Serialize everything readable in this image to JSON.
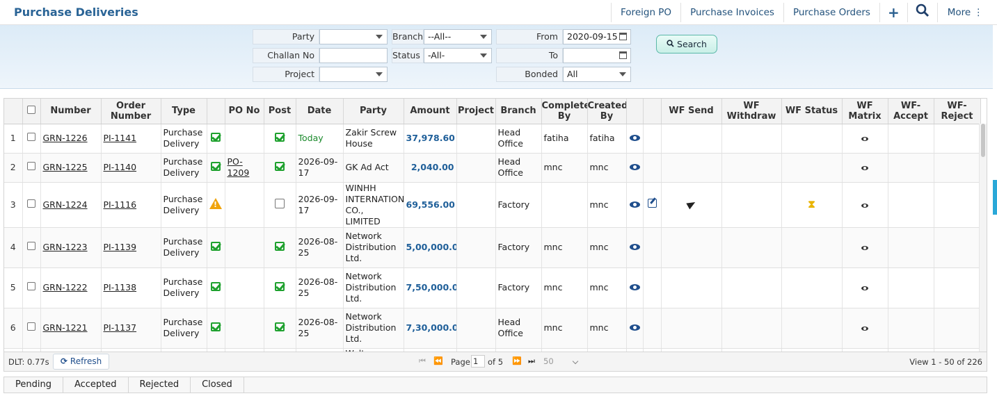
{
  "header": {
    "title": "Purchase Deliveries",
    "nav": [
      "Foreign PO",
      "Purchase Invoices",
      "Purchase Orders"
    ],
    "add_label": "+",
    "more_label": "More ⋮"
  },
  "filters": {
    "party_label": "Party",
    "party_value": "",
    "branch_label": "Branch",
    "branch_value": "--All--",
    "from_label": "From",
    "from_value": "2020-09-15",
    "challan_label": "Challan No",
    "challan_value": "",
    "status_label": "Status",
    "status_value": "-All-",
    "to_label": "To",
    "to_value": "",
    "project_label": "Project",
    "project_value": "",
    "bonded_label": "Bonded",
    "bonded_value": "All",
    "search_label": "Search"
  },
  "grid": {
    "columns": [
      "Number",
      "Order Number",
      "Type",
      "",
      "PO No",
      "Post",
      "Date",
      "Party",
      "Amount",
      "Project",
      "Branch",
      "Completed By",
      "Created By",
      "",
      "",
      "WF Send",
      "WF Withdraw",
      "WF Status",
      "WF Matrix",
      "WF-Accept",
      "WF-Reject"
    ],
    "rows": [
      {
        "n": "1",
        "number": "GRN-1226",
        "order": "PI-1141",
        "type": "Purchase Delivery",
        "status": "ok",
        "po": "",
        "post": true,
        "date": "Today",
        "party": "Zakir Screw House",
        "amount": "37,978.60",
        "project": "",
        "branch": "Head Office",
        "completed": "fatiha",
        "created": "fatiha",
        "edit": false,
        "send": false,
        "wfstatus": false
      },
      {
        "n": "2",
        "number": "GRN-1225",
        "order": "PI-1140",
        "type": "Purchase Delivery",
        "status": "ok",
        "po": "PO-1209",
        "post": true,
        "date": "2026-09-17",
        "party": "GK Ad Act",
        "amount": "2,040.00",
        "project": "",
        "branch": "Head Office",
        "completed": "mnc",
        "created": "mnc",
        "edit": false,
        "send": false,
        "wfstatus": false
      },
      {
        "n": "3",
        "number": "GRN-1224",
        "order": "PI-1116",
        "type": "Purchase Delivery",
        "status": "warn",
        "po": "",
        "post": false,
        "date": "2026-09-17",
        "party": "WINHH INTERNATIONAL CO., LIMITED",
        "amount": "69,556.00",
        "project": "",
        "branch": "Factory",
        "completed": "",
        "created": "mnc",
        "edit": true,
        "send": true,
        "wfstatus": true
      },
      {
        "n": "4",
        "number": "GRN-1223",
        "order": "PI-1139",
        "type": "Purchase Delivery",
        "status": "ok",
        "po": "",
        "post": true,
        "date": "2026-08-25",
        "party": "Network Distribution Ltd.",
        "amount": "5,00,000.00",
        "project": "",
        "branch": "Factory",
        "completed": "mnc",
        "created": "mnc",
        "edit": false,
        "send": false,
        "wfstatus": false
      },
      {
        "n": "5",
        "number": "GRN-1222",
        "order": "PI-1138",
        "type": "Purchase Delivery",
        "status": "ok",
        "po": "",
        "post": true,
        "date": "2026-08-25",
        "party": "Network Distribution Ltd.",
        "amount": "7,50,000.00",
        "project": "",
        "branch": "Factory",
        "completed": "mnc",
        "created": "mnc",
        "edit": false,
        "send": false,
        "wfstatus": false
      },
      {
        "n": "6",
        "number": "GRN-1221",
        "order": "PI-1137",
        "type": "Purchase Delivery",
        "status": "ok",
        "po": "",
        "post": true,
        "date": "2026-08-25",
        "party": "Network Distribution Ltd.",
        "amount": "7,30,000.00",
        "project": "",
        "branch": "Head Office",
        "completed": "mnc",
        "created": "mnc",
        "edit": false,
        "send": false,
        "wfstatus": false
      }
    ],
    "partial_row_party": "Walton Hitech"
  },
  "pager": {
    "dlt": "DLT: 0.77s",
    "refresh_label": "Refresh",
    "page_label": "Page",
    "page_value": "1",
    "of_label": "of 5",
    "rows_per_page": "50",
    "view_info": "View 1 - 50 of 226"
  },
  "status_tabs": [
    "Pending",
    "Accepted",
    "Rejected",
    "Closed"
  ],
  "colors": {
    "title": "#2a6496",
    "amount": "#1f5f99",
    "ok": "#1ea12e",
    "warn": "#f0a30a",
    "filter_bg": "#dcebf7"
  }
}
